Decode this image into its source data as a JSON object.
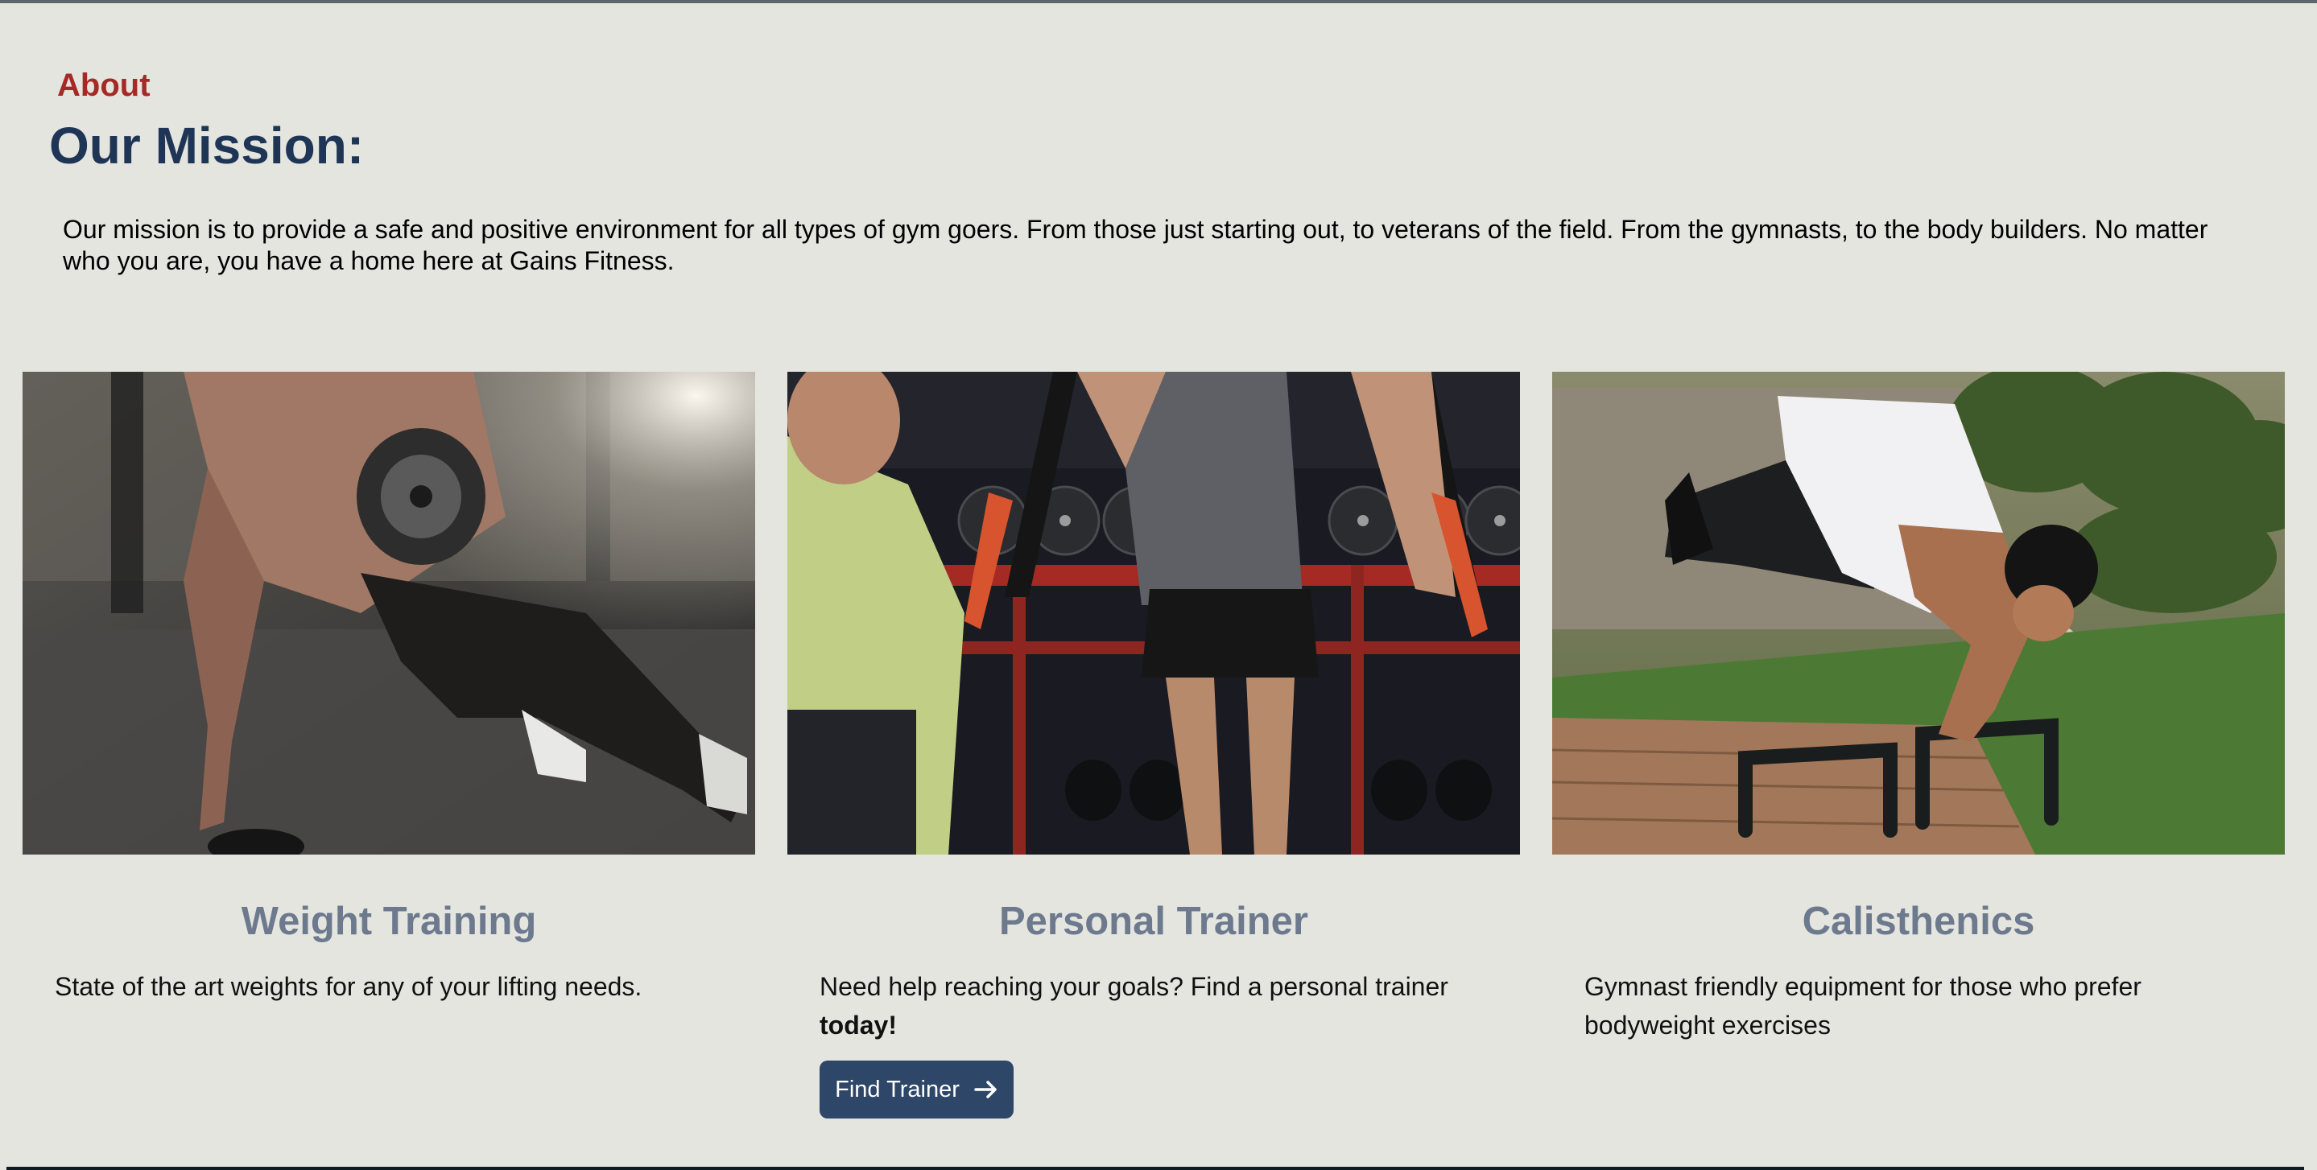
{
  "about": {
    "label": "About",
    "title": "Our Mission:",
    "text": "Our mission is to provide a safe and positive environment for all types of gym goers. From those just starting out, to veterans of the field. From the gymnasts, to the body builders. No matter who you are, you have a home here at Gains Fitness."
  },
  "cards": [
    {
      "title": "Weight Training",
      "text": "State of the art weights for any of your lifting needs."
    },
    {
      "title": "Personal Trainer",
      "text": "Need help reaching your goals? Find a personal trainer ",
      "text_bold": "today!",
      "button_label": "Find Trainer"
    },
    {
      "title": "Calisthenics",
      "text": "Gymnast friendly equipment for those who prefer bodyweight exercises"
    }
  ],
  "icons": {
    "button_icon": "arrow-right-icon"
  },
  "colors": {
    "background": "#e5e5e0",
    "accent_red": "#a52a27",
    "heading_navy": "#1e3556",
    "card_title": "#6d7a8e",
    "button_bg": "#2e4668"
  }
}
